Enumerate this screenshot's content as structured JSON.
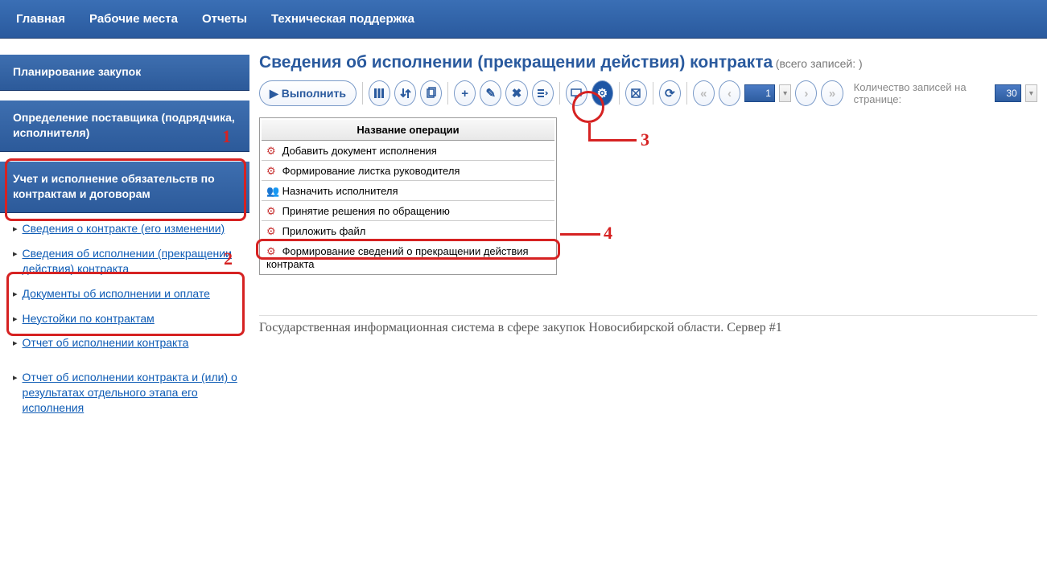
{
  "topnav": [
    "Главная",
    "Рабочие места",
    "Отчеты",
    "Техническая поддержка"
  ],
  "sidebar": {
    "section_planning": "Планирование закупок",
    "section_supplier": "Определение поставщика (подрядчика, исполнителя)",
    "section_contracts": "Учет и исполнение обязательств по контрактам и договорам",
    "links": [
      "Сведения о контракте (его изменении)",
      "Сведения об исполнении (прекращении действия) контракта",
      "Документы об исполнении и оплате",
      "Неустойки по контрактам",
      "Отчет об исполнении контракта",
      "Отчет об исполнении контракта и (или) о результатах отдельного этапа его исполнения"
    ]
  },
  "page": {
    "title": "Сведения об исполнении (прекращении действия) контракта",
    "suffix": "(всего записей:  )"
  },
  "toolbar": {
    "execute_label": "Выполнить"
  },
  "table": {
    "header": "Название операции",
    "rows": [
      "Добавить документ исполнения",
      "Формирование листка руководителя",
      "Назначить исполнителя",
      "Принятие решения по обращению",
      "Приложить файл",
      "Формирование сведений о прекращении действия контракта"
    ]
  },
  "pager": {
    "page_number": "1",
    "label": "Количество записей на странице:",
    "per_page": "30"
  },
  "footer": "Государственная информационная система в сфере закупок Новосибирской области. Сервер #1",
  "callouts": {
    "c1": "1",
    "c2": "2",
    "c3": "3",
    "c4": "4"
  }
}
